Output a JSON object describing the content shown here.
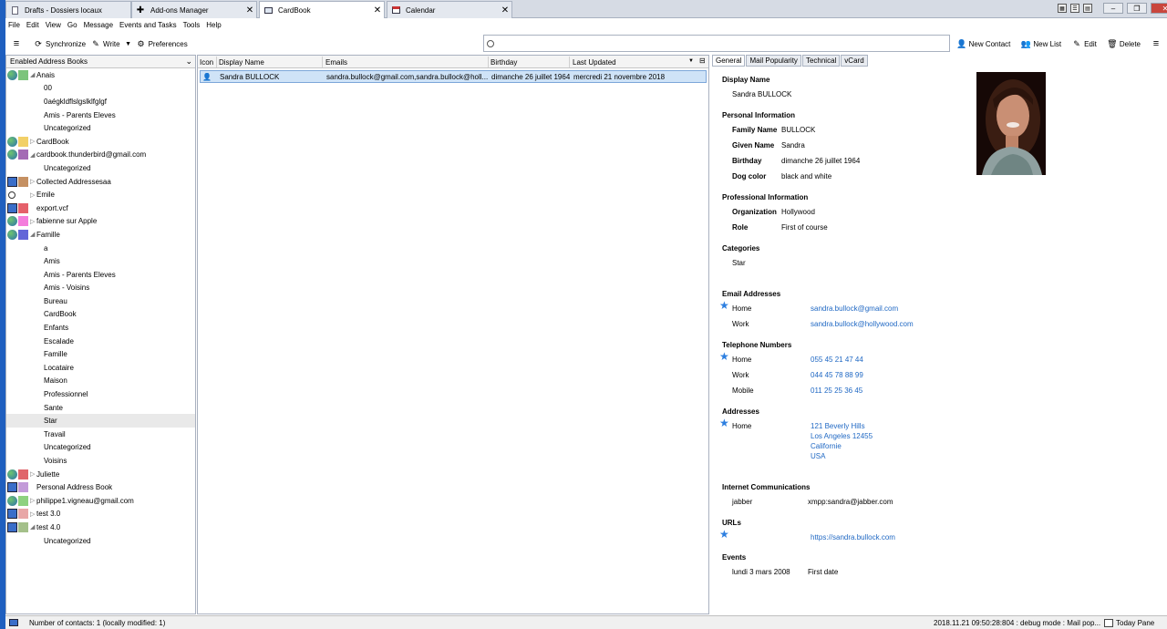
{
  "tabs": [
    {
      "label": "Drafts - Dossiers locaux",
      "icon": "document-icon"
    },
    {
      "label": "Add-ons Manager",
      "icon": "puzzle-icon"
    },
    {
      "label": "CardBook",
      "icon": "cardbook-icon"
    },
    {
      "label": "Calendar",
      "icon": "calendar-icon"
    }
  ],
  "menu": [
    "File",
    "Edit",
    "View",
    "Go",
    "Message",
    "Events and Tasks",
    "Tools",
    "Help"
  ],
  "toolbar": {
    "synchronize": "Synchronize",
    "write": "Write",
    "preferences": "Preferences",
    "new_contact": "New Contact",
    "new_list": "New List",
    "edit": "Edit",
    "delete": "Delete"
  },
  "address_books": {
    "header": "Enabled Address Books",
    "rows": [
      {
        "label": "Anais",
        "icon": "globe-icon",
        "color": "#7cc47c",
        "twisty": "◢",
        "level": 0
      },
      {
        "label": "00",
        "level": 1
      },
      {
        "label": "0aégkldflslgslklfglgf",
        "level": 1
      },
      {
        "label": "Amis - Parents Eleves",
        "level": 1
      },
      {
        "label": "Uncategorized",
        "level": 1
      },
      {
        "label": "CardBook",
        "icon": "globe-icon",
        "color": "#f2d068",
        "twisty": "▷",
        "level": 0
      },
      {
        "label": "cardbook.thunderbird@gmail.com",
        "icon": "globe-icon",
        "color": "#a46bb5",
        "twisty": "◢",
        "level": 0
      },
      {
        "label": "Uncategorized",
        "level": 1
      },
      {
        "label": "Collected Addressesaa",
        "icon": "computer-icon",
        "color": "#c59062",
        "twisty": "▷",
        "level": 0
      },
      {
        "label": "Emile",
        "icon": "search-icon",
        "color": "",
        "twisty": "▷",
        "level": 0
      },
      {
        "label": "export.vcf",
        "icon": "computer-icon",
        "color": "#e5606a",
        "twisty": "",
        "level": 0
      },
      {
        "label": "fabienne sur Apple",
        "icon": "globe-icon",
        "color": "#f47ddc",
        "twisty": "▷",
        "level": 0
      },
      {
        "label": "Famille",
        "icon": "globe-icon",
        "color": "#6366d8",
        "twisty": "◢",
        "level": 0
      },
      {
        "label": "a",
        "level": 1
      },
      {
        "label": "Amis",
        "level": 1
      },
      {
        "label": "Amis - Parents Eleves",
        "level": 1
      },
      {
        "label": "Amis - Voisins",
        "level": 1
      },
      {
        "label": "Bureau",
        "level": 1
      },
      {
        "label": "CardBook",
        "level": 1
      },
      {
        "label": "Enfants",
        "level": 1
      },
      {
        "label": "Escalade",
        "level": 1
      },
      {
        "label": "Famille",
        "level": 1
      },
      {
        "label": "Locataire",
        "level": 1
      },
      {
        "label": "Maison",
        "level": 1
      },
      {
        "label": "Professionnel",
        "level": 1
      },
      {
        "label": "Sante",
        "level": 1
      },
      {
        "label": "Star",
        "level": 1,
        "selected": true
      },
      {
        "label": "Travail",
        "level": 1
      },
      {
        "label": "Uncategorized",
        "level": 1
      },
      {
        "label": "Voisins",
        "level": 1
      },
      {
        "label": "Juliette",
        "icon": "globe-icon",
        "color": "#e0656b",
        "twisty": "▷",
        "level": 0
      },
      {
        "label": "Personal Address Book",
        "icon": "computer-icon",
        "color": "#c39bd9",
        "twisty": "",
        "level": 0
      },
      {
        "label": "philippe1.vigneau@gmail.com",
        "icon": "globe-icon",
        "color": "#8ed17f",
        "twisty": "▷",
        "level": 0
      },
      {
        "label": "test 3.0",
        "icon": "computer-icon",
        "color": "#e8a7a7",
        "twisty": "▷",
        "level": 0
      },
      {
        "label": "test 4.0",
        "icon": "computer-icon",
        "color": "#a4c08a",
        "twisty": "◢",
        "level": 0
      },
      {
        "label": "Uncategorized",
        "level": 1
      }
    ]
  },
  "contacts": {
    "columns": {
      "icon": "Icon",
      "display_name": "Display Name",
      "emails": "Emails",
      "birthday": "Birthday",
      "last_updated": "Last Updated"
    },
    "rows": [
      {
        "display_name": "Sandra BULLOCK",
        "emails": "sandra.bullock@gmail.com,sandra.bullock@holl...",
        "birthday": "dimanche 26 juillet 1964",
        "last_updated": "mercredi 21 novembre 2018"
      }
    ]
  },
  "detail": {
    "tabs": [
      "General",
      "Mail Popularity",
      "Technical",
      "vCard"
    ],
    "display_name_title": "Display Name",
    "display_name": "Sandra BULLOCK",
    "personal_title": "Personal Information",
    "personal": [
      {
        "label": "Family Name",
        "value": "BULLOCK"
      },
      {
        "label": "Given Name",
        "value": "Sandra"
      },
      {
        "label": "Birthday",
        "value": "dimanche 26 juillet 1964"
      },
      {
        "label": "Dog color",
        "value": "black and white"
      }
    ],
    "professional_title": "Professional Information",
    "professional": [
      {
        "label": "Organization",
        "value": "Hollywood"
      },
      {
        "label": "Role",
        "value": "First of course"
      }
    ],
    "categories_title": "Categories",
    "category": "Star",
    "emails_title": "Email Addresses",
    "emails": [
      {
        "type": "Home",
        "value": "sandra.bullock@gmail.com"
      },
      {
        "type": "Work",
        "value": "sandra.bullock@hollywood.com"
      }
    ],
    "phones_title": "Telephone Numbers",
    "phones": [
      {
        "type": "Home",
        "value": "055 45 21 47 44"
      },
      {
        "type": "Work",
        "value": "044 45 78 88 99"
      },
      {
        "type": "Mobile",
        "value": "011 25 25 36 45"
      }
    ],
    "addresses_title": "Addresses",
    "address_type": "Home",
    "address_lines": [
      "121 Beverly Hills",
      "Los Angeles 12455",
      "Californie",
      "USA"
    ],
    "im_title": "Internet Communications",
    "im_type": "jabber",
    "im_value": "xmpp:sandra@jabber.com",
    "urls_title": "URLs",
    "url": "https://sandra.bullock.com",
    "events_title": "Events",
    "event_date": "lundi 3 mars 2008",
    "event_label": "First date"
  },
  "status": {
    "count": "Number of contacts: 1 (locally modified: 1)",
    "debug": "2018.11.21 09:50:28:804 : debug mode : Mail pop...",
    "today_pane": "Today Pane"
  }
}
